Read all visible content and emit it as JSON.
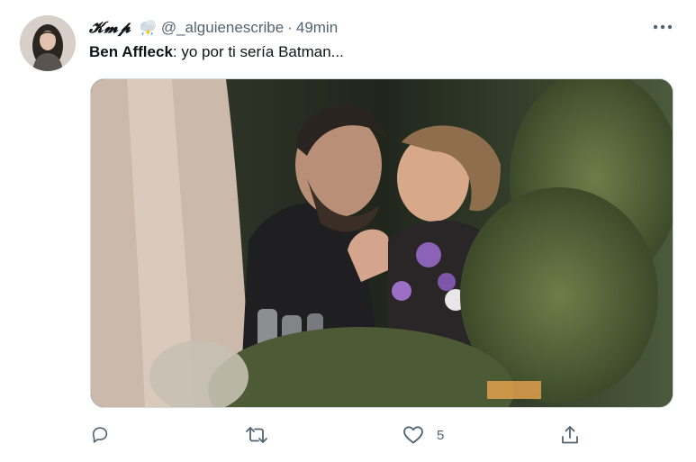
{
  "tweet": {
    "display_name": "𝓚𝓶𝓹",
    "name_emoji": "cloud-rain-icon",
    "handle": "@_alguienescribe",
    "separator": "·",
    "time": "49min",
    "text_bold": "Ben Affleck",
    "text_rest": ": yo por ti sería Batman...",
    "media_icon": "photo-couple-kissing",
    "actions": {
      "reply_count": "",
      "retweet_count": "",
      "like_count": "5",
      "share_count": ""
    }
  }
}
